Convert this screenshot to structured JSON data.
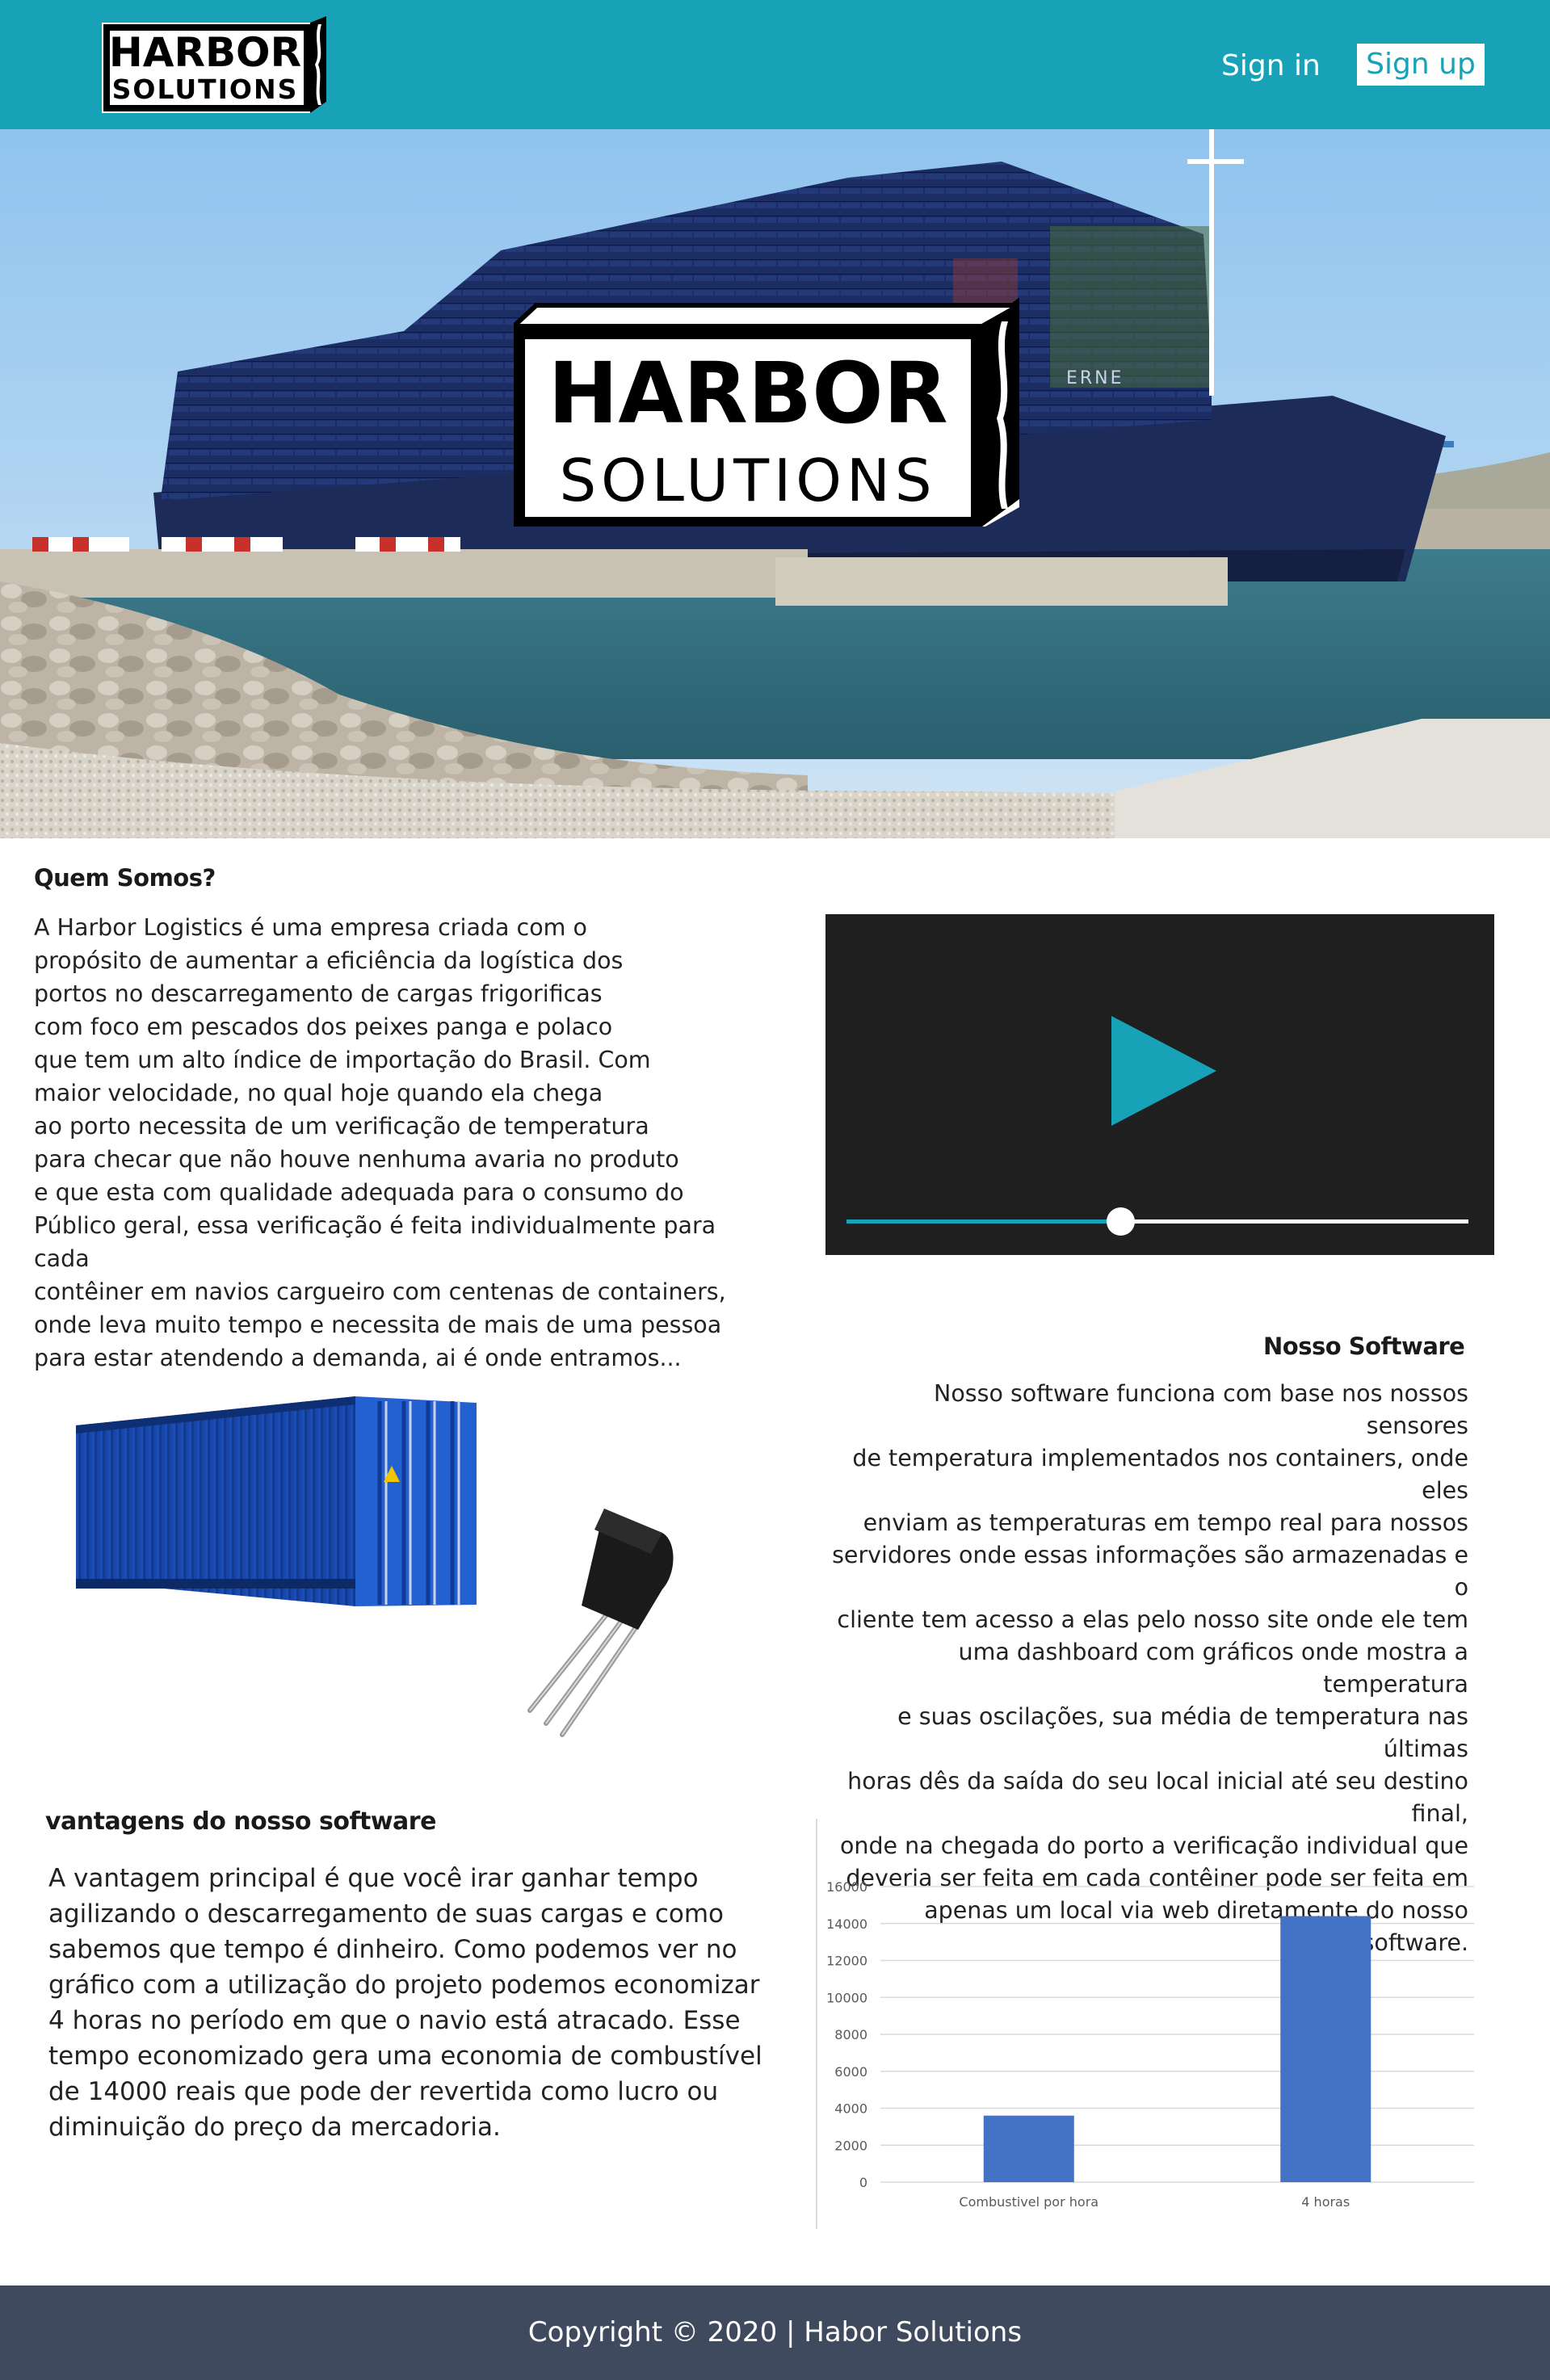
{
  "header": {
    "brand_line1": "HARBOR",
    "brand_line2": "SOLUTIONS",
    "nav": {
      "signin": "Sign in",
      "signup": "Sign up"
    },
    "colors": {
      "bar": "#17a2b8",
      "signup_bg": "#ffffff"
    }
  },
  "hero": {
    "brand_line1": "HARBOR",
    "brand_line2": "SOLUTIONS",
    "ship_text": "ERNE"
  },
  "about": {
    "heading": "Quem Somos?",
    "text": "A Harbor Logistics é uma empresa criada com o\npropósito de aumentar a eficiência da logística dos\nportos no descarregamento de cargas frigorificas\n com foco em pescados dos peixes panga e polaco\n que tem um alto índice de importação do Brasil. Com\n maior velocidade, no qual hoje quando ela chega\n ao porto necessita de  um verificação de temperatura\n para checar que não houve nenhuma avaria no produto\n e que esta com qualidade adequada para o consumo do\n Público geral, essa verificação é feita individualmente para cada\n contêiner em navios cargueiro com centenas de containers,\n onde leva muito tempo e necessita de mais de uma pessoa\n para estar atendendo a demanda, ai é onde entramos..."
  },
  "video": {
    "progress": 0.44,
    "icons": [
      "play-icon"
    ]
  },
  "software": {
    "heading": "Nosso Software",
    "text": "Nosso software funciona com base nos nossos sensores\nde temperatura implementados nos containers, onde eles\nenviam as temperaturas em tempo real para nossos\nservidores onde essas informações são armazenadas e o\ncliente tem acesso a elas pelo nosso site onde ele tem\numa dashboard com gráficos onde mostra a temperatura\ne suas oscilações, sua média de temperatura nas últimas\nhoras dês da saída do seu local inicial até seu destino final,\nonde na chegada do porto a verificação individual que\ndeveria ser  feita em cada contêiner pode ser feita em\napenas um local via web diretamente do nosso software."
  },
  "advantages": {
    "heading": "vantagens do nosso software",
    "text": "A vantagem principal é que você irar ganhar tempo\nagilizando o descarregamento de suas cargas e como\nsabemos que tempo é dinheiro. Como podemos ver no\ngráfico com a utilização do projeto podemos economizar\n4 horas no período em que o navio está atracado. Esse\ntempo economizado gera uma economia de combustível\nde 14000 reais que pode der revertida como lucro ou\ndiminuição do preço da mercadoria."
  },
  "chart_data": {
    "type": "bar",
    "categories": [
      "Combustivel por hora",
      "4 horas"
    ],
    "values": [
      3600,
      14400
    ],
    "ylim": [
      0,
      16000
    ],
    "yticks": [
      0,
      2000,
      4000,
      6000,
      8000,
      10000,
      12000,
      14000,
      16000
    ],
    "grid": true,
    "bar_color": "#4472c4",
    "title": "",
    "xlabel": "",
    "ylabel": ""
  },
  "footer": {
    "copyright": "Copyright © 2020 | Habor Solutions",
    "color": "#3f4a5e"
  }
}
